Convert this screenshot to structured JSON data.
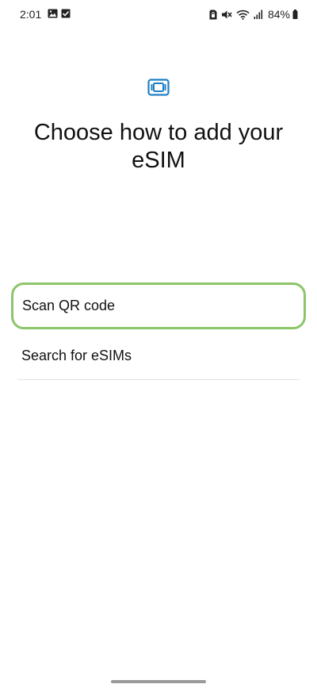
{
  "status_bar": {
    "time": "2:01",
    "battery_percent": "84%",
    "left_icons": [
      "image-icon",
      "checkbox-icon"
    ],
    "right_icons": [
      "sim-lock-icon",
      "vibrate-mute-icon",
      "wifi-icon",
      "signal-icon",
      "battery-icon"
    ]
  },
  "header": {
    "icon": "esim-chip-icon",
    "title": "Choose how to add your eSIM"
  },
  "options": [
    {
      "label": "Scan QR code",
      "focused": true
    },
    {
      "label": "Search for eSIMs",
      "focused": false
    }
  ],
  "colors": {
    "accent": "#1e7fc4",
    "focus_ring": "#8cc56a",
    "divider": "#e4e4e4"
  }
}
